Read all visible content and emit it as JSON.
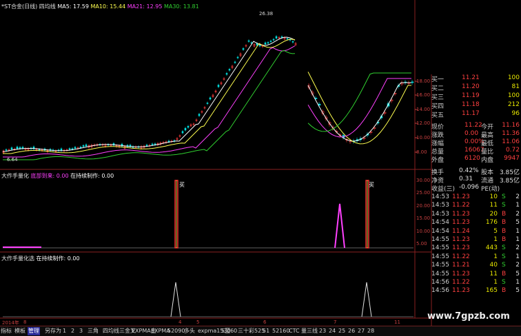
{
  "main_header": {
    "title": "*ST合金(日线)",
    "indicator": "四均线",
    "ma5": "MA5: 17.59",
    "ma10": "MA10: 15.44",
    "ma21": "MA21: 12.95",
    "ma30": "MA30: 13.81"
  },
  "main_annotations": {
    "high": "26.38",
    "low": "6.64"
  },
  "sub1_header": {
    "name": "大作手量化",
    "s1": "底部到来: 0.00",
    "s2": "在持续制作: 0.00"
  },
  "sub2_header": {
    "name": "大作手量化选",
    "s1": "在持续制作: 0.00"
  },
  "buy_mark": "买",
  "price_axis": [
    "18.00",
    "16.00",
    "14.00",
    "12.00",
    "10.00",
    "8.00"
  ],
  "sub1_axis": [
    "30.00",
    "25.00",
    "20.00",
    "15.00",
    "10.00",
    "5.00"
  ],
  "date_axis": [
    "2014年",
    "8",
    "4",
    "5",
    "6",
    "7",
    "11"
  ],
  "colors": {
    "up": "#ff3c3c",
    "down": "#00e0e0",
    "ma5": "#ffffff",
    "ma10": "#ffff50",
    "ma21": "#ff40ff",
    "ma30": "#30d030",
    "volume_level": "#ff3030"
  },
  "quote": {
    "buy_levels": [
      {
        "label": "买一",
        "price": "11.21",
        "vol": "100"
      },
      {
        "label": "买二",
        "price": "11.20",
        "vol": "81"
      },
      {
        "label": "买三",
        "price": "11.19",
        "vol": "100"
      },
      {
        "label": "买四",
        "price": "11.18",
        "vol": "212"
      },
      {
        "label": "买五",
        "price": "11.17",
        "vol": "96"
      }
    ],
    "stats": [
      {
        "l1": "现价",
        "v1": "11.22",
        "l2": "今开",
        "v2": "11.16"
      },
      {
        "l1": "涨跌",
        "v1": "0.00",
        "l2": "最高",
        "v2": "11.36"
      },
      {
        "l1": "涨幅",
        "v1": "0.00%",
        "l2": "最低",
        "v2": "11.06"
      },
      {
        "l1": "总量",
        "v1": "16067",
        "l2": "量比",
        "v2": "0.72"
      },
      {
        "l1": "外盘",
        "v1": "6120",
        "l2": "内盘",
        "v2": "9947"
      }
    ],
    "stats2": [
      {
        "l1": "换手",
        "v1": "0.42%",
        "l2": "股本",
        "v2": "3.85亿"
      },
      {
        "l1": "净资",
        "v1": "0.31",
        "l2": "流通",
        "v2": "3.85亿"
      },
      {
        "l1": "收益(三)",
        "v1": "-0.096",
        "l2": "PE(动)",
        "v2": ""
      }
    ],
    "trades": [
      {
        "t": "14:53",
        "p": "11.23",
        "v": "10",
        "s": "S",
        "n": "2"
      },
      {
        "t": "14:53",
        "p": "11.22",
        "v": "11",
        "s": "S",
        "n": "1"
      },
      {
        "t": "14:53",
        "p": "11.23",
        "v": "20",
        "s": "B",
        "n": "2"
      },
      {
        "t": "14:54",
        "p": "11.23",
        "v": "176",
        "s": "B",
        "n": "5"
      },
      {
        "t": "14:54",
        "p": "11.24",
        "v": "5",
        "s": "B",
        "n": "1"
      },
      {
        "t": "14:55",
        "p": "11.23",
        "v": "1",
        "s": "B",
        "n": "1"
      },
      {
        "t": "14:55",
        "p": "11.23",
        "v": "443",
        "s": "S",
        "n": "2"
      },
      {
        "t": "14:55",
        "p": "11.22",
        "v": "1",
        "s": "S",
        "n": "1"
      },
      {
        "t": "14:55",
        "p": "11.21",
        "v": "40",
        "s": "S",
        "n": "2"
      },
      {
        "t": "14:55",
        "p": "11.23",
        "v": "11",
        "s": "B",
        "n": "5"
      },
      {
        "t": "14:56",
        "p": "11.22",
        "v": "1",
        "s": "S",
        "n": "1"
      },
      {
        "t": "14:56",
        "p": "11.23",
        "v": "165",
        "s": "B",
        "n": "5"
      }
    ]
  },
  "tabs": [
    "指标",
    "模板",
    "管理",
    "另存为",
    "1",
    "2",
    "3",
    "三角",
    "四均线三金叉",
    "EXPMA主",
    "EXPMA",
    "52090",
    "多头",
    "expma1530",
    "5至60",
    "三十彩525",
    "51",
    "52160",
    "CTC",
    "量三线",
    "23",
    "24",
    "25",
    "26",
    "27",
    "28"
  ],
  "active_tab": 2,
  "watermark": "www.7gpzb.com"
}
